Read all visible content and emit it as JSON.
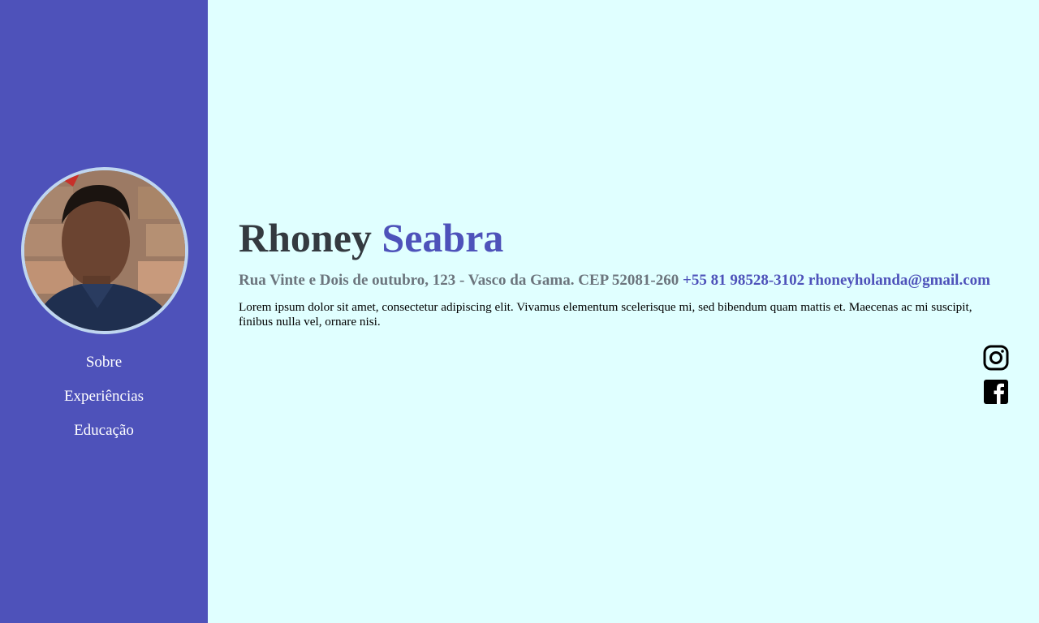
{
  "profile": {
    "first_name": "Rhoney",
    "last_name": "Seabra",
    "address": "Rua Vinte e Dois de outubro, 123 - Vasco da Gama. CEP 52081-260 ",
    "phone": "+55 81 98528-3102",
    "email": "rhoneyholanda@gmail.com",
    "about": "Lorem ipsum dolor sit amet, consectetur adipiscing elit. Vivamus elementum scelerisque mi, sed bibendum quam mattis et. Maecenas ac mi suscipit, finibus nulla vel, ornare nisi."
  },
  "sidebar": {
    "avatar_icon": "profile-photo",
    "nav": [
      {
        "label": "Sobre"
      },
      {
        "label": "Experiências"
      },
      {
        "label": "Educação"
      }
    ]
  },
  "social": [
    {
      "icon": "instagram-icon"
    },
    {
      "icon": "facebook-icon"
    }
  ],
  "colors": {
    "sidebar_bg": "#4e52ba",
    "page_bg": "#e0ffff",
    "accent": "#4e52ba",
    "name_dark": "#343a40",
    "muted": "#6c757d",
    "avatar_border": "#bfd6f0"
  }
}
